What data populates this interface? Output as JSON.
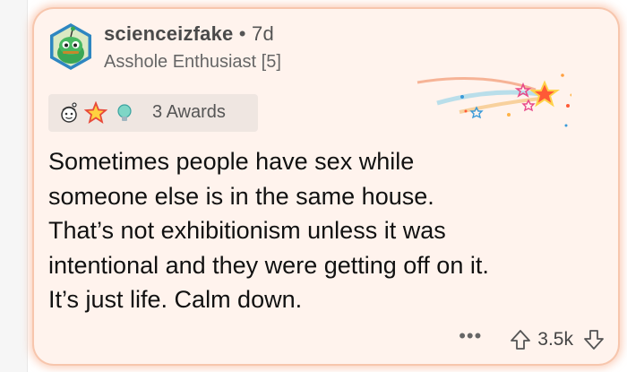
{
  "comment": {
    "author": "scienceizfake",
    "separator": "•",
    "age": "7d",
    "flair": "Asshole Enthusiast [5]",
    "awards": {
      "count_label": "3 Awards",
      "icons": [
        "gold-head-award-icon",
        "star-struck-award-icon",
        "lightbulb-award-icon"
      ]
    },
    "body_lines": [
      "Sometimes people have sex while",
      "someone else is in the same house.",
      "That’s not exhibitionism unless it was",
      "intentional and they were getting off on it.",
      "It’s just life. Calm down."
    ],
    "score": "3.5k",
    "more_label": "•••",
    "icons": {
      "avatar": "snoo-avatar-icon",
      "banner": "shooting-star-banner-icon",
      "upvote": "upvote-arrow-icon",
      "downvote": "downvote-arrow-icon"
    }
  },
  "colors": {
    "card_bg": "#fff3ed",
    "card_glow": "#f6a078",
    "avatar_ring": "#2e86c1",
    "snoo_green": "#3aa655"
  }
}
